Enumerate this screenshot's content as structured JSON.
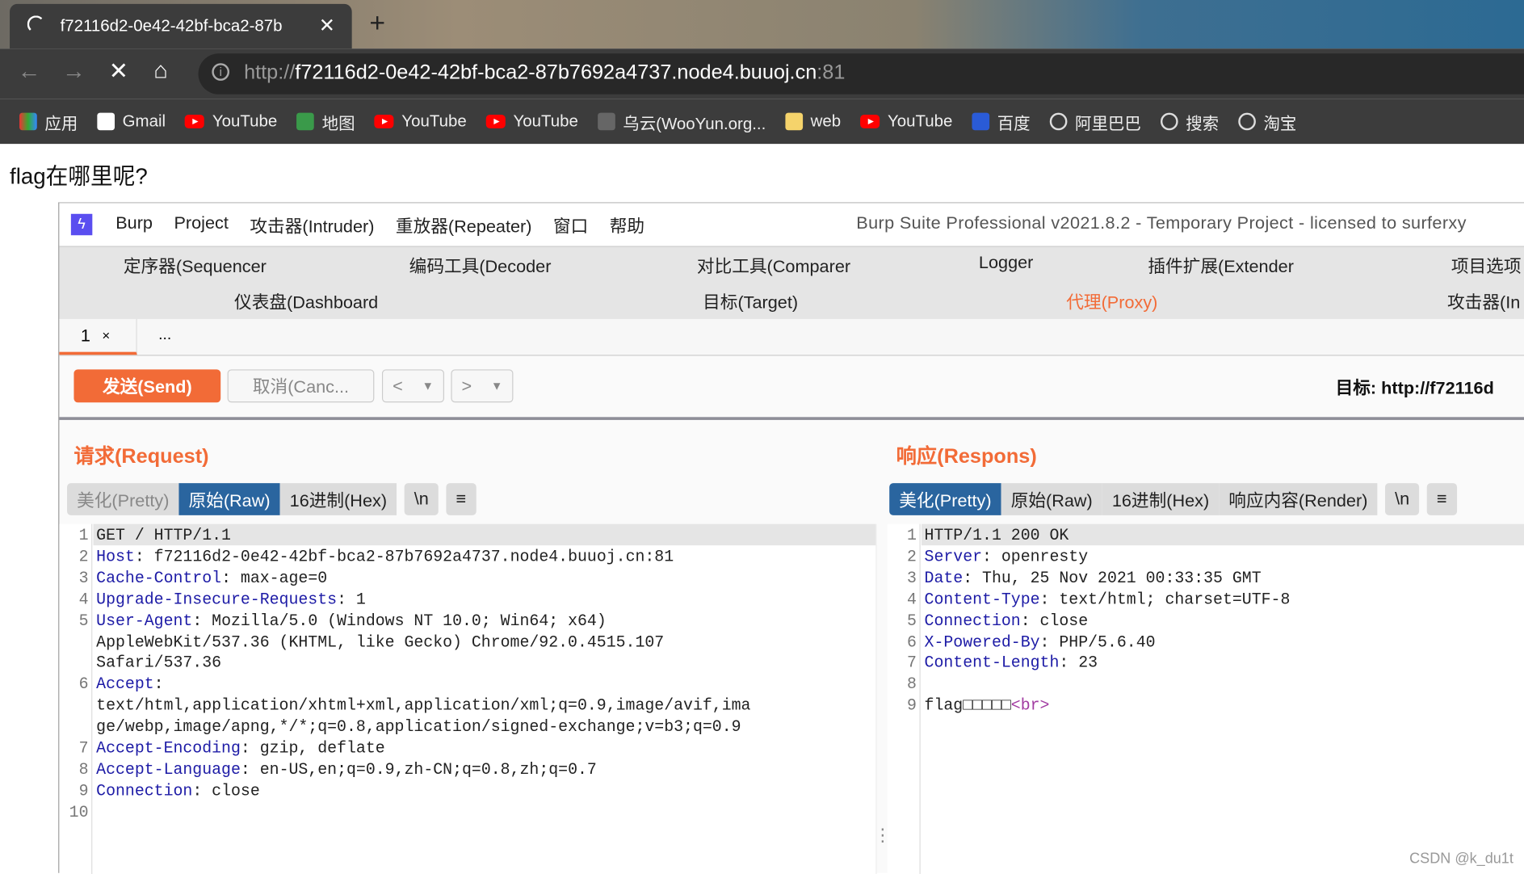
{
  "browser": {
    "tab_title": "f72116d2-0e42-42bf-bca2-87b",
    "url_prefix": "http://",
    "url_host": "f72116d2-0e42-42bf-bca2-87b7692a4737.node4.buuoj.cn",
    "url_port": ":81",
    "bookmarks": [
      {
        "label": "应用",
        "icon": "apps-icon"
      },
      {
        "label": "Gmail",
        "icon": "google-icon"
      },
      {
        "label": "YouTube",
        "icon": "youtube-icon"
      },
      {
        "label": "地图",
        "icon": "maps-icon"
      },
      {
        "label": "YouTube",
        "icon": "youtube-icon"
      },
      {
        "label": "YouTube",
        "icon": "youtube-icon"
      },
      {
        "label": "乌云(WooYun.org...",
        "icon": "cloud-icon"
      },
      {
        "label": "web",
        "icon": "folder-icon"
      },
      {
        "label": "YouTube",
        "icon": "youtube-icon"
      },
      {
        "label": "百度",
        "icon": "baidu-icon"
      },
      {
        "label": "阿里巴巴",
        "icon": "globe-icon"
      },
      {
        "label": "搜索",
        "icon": "globe-icon"
      },
      {
        "label": "淘宝",
        "icon": "globe-icon"
      }
    ]
  },
  "page": {
    "text": "flag在哪里呢?"
  },
  "burp": {
    "menu": [
      "Burp",
      "Project",
      "攻击器(Intruder)",
      "重放器(Repeater)",
      "窗口",
      "帮助"
    ],
    "title": "Burp Suite Professional v2021.8.2 - Temporary Project - licensed to surferxy",
    "nav_row1": [
      "定序器(Sequencer",
      "编码工具(Decoder",
      "对比工具(Comparer",
      "Logger",
      "插件扩展(Extender",
      "项目选项"
    ],
    "nav_row2": [
      "仪表盘(Dashboard",
      "目标(Target)",
      "代理(Proxy)",
      "攻击器(In"
    ],
    "active_nav": "代理(Proxy)",
    "accent": "#f26b37",
    "repeater_tabs": [
      "1",
      "..."
    ],
    "tab_close": "×",
    "send": "发送(Send)",
    "cancel": "取消(Canc...",
    "target_label": "目标: http://f72116d",
    "request": {
      "title": "请求(Request)",
      "views": [
        "美化(Pretty)",
        "原始(Raw)",
        "16进制(Hex)",
        "\\n",
        "≡"
      ],
      "active": "原始(Raw)",
      "lines": [
        {
          "n": "1",
          "k": "",
          "v": "GET / HTTP/1.1"
        },
        {
          "n": "2",
          "k": "Host",
          "v": ": f72116d2-0e42-42bf-bca2-87b7692a4737.node4.buuoj.cn:81"
        },
        {
          "n": "3",
          "k": "Cache-Control",
          "v": ": max-age=0"
        },
        {
          "n": "4",
          "k": "Upgrade-Insecure-Requests",
          "v": ": 1"
        },
        {
          "n": "5",
          "k": "User-Agent",
          "v": ": Mozilla/5.0 (Windows NT 10.0; Win64; x64)"
        },
        {
          "n": "",
          "k": "",
          "v": "AppleWebKit/537.36 (KHTML, like Gecko) Chrome/92.0.4515.107"
        },
        {
          "n": "",
          "k": "",
          "v": "Safari/537.36"
        },
        {
          "n": "6",
          "k": "Accept",
          "v": ":"
        },
        {
          "n": "",
          "k": "",
          "v": "text/html,application/xhtml+xml,application/xml;q=0.9,image/avif,ima"
        },
        {
          "n": "",
          "k": "",
          "v": "ge/webp,image/apng,*/*;q=0.8,application/signed-exchange;v=b3;q=0.9"
        },
        {
          "n": "7",
          "k": "Accept-Encoding",
          "v": ": gzip, deflate"
        },
        {
          "n": "8",
          "k": "Accept-Language",
          "v": ": en-US,en;q=0.9,zh-CN;q=0.8,zh;q=0.7"
        },
        {
          "n": "9",
          "k": "Connection",
          "v": ": close"
        },
        {
          "n": "10",
          "k": "",
          "v": ""
        }
      ]
    },
    "response": {
      "title": "响应(Respons)",
      "views": [
        "美化(Pretty)",
        "原始(Raw)",
        "16进制(Hex)",
        "响应内容(Render)",
        "\\n",
        "≡"
      ],
      "active": "美化(Pretty)",
      "lines": [
        {
          "n": "1",
          "k": "",
          "v": "HTTP/1.1 200 OK"
        },
        {
          "n": "2",
          "k": "Server",
          "v": ": openresty"
        },
        {
          "n": "3",
          "k": "Date",
          "v": ": Thu, 25 Nov 2021 00:33:35 GMT"
        },
        {
          "n": "4",
          "k": "Content-Type",
          "v": ": text/html; charset=UTF-8"
        },
        {
          "n": "5",
          "k": "Connection",
          "v": ": close"
        },
        {
          "n": "6",
          "k": "X-Powered-By",
          "v": ": PHP/5.6.40"
        },
        {
          "n": "7",
          "k": "Content-Length",
          "v": ": 23"
        },
        {
          "n": "8",
          "k": "",
          "v": ""
        },
        {
          "n": "9",
          "k": "",
          "v": "flag□□□□□",
          "tag": "<br>"
        }
      ]
    }
  },
  "watermark": "CSDN @k_du1t"
}
